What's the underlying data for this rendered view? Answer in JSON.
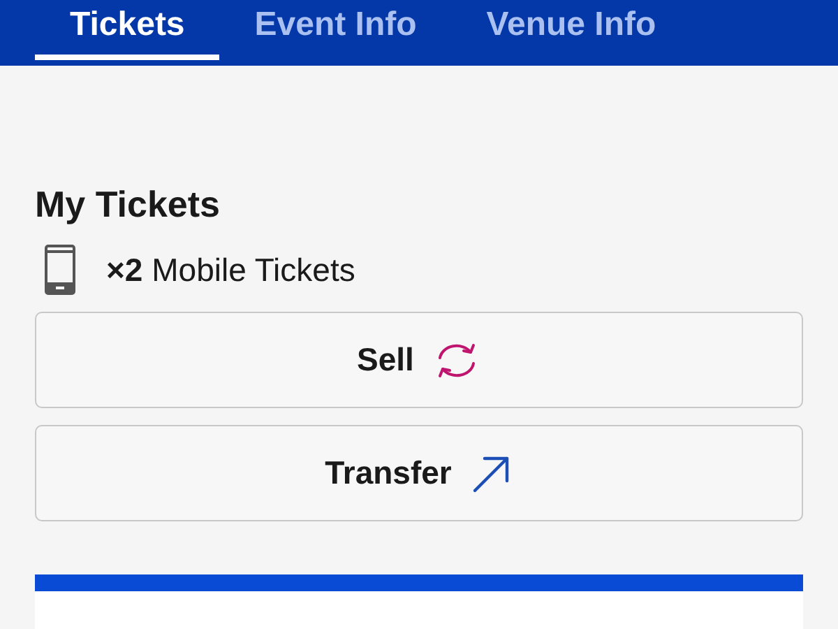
{
  "tabs": [
    {
      "label": "Tickets",
      "selected": true
    },
    {
      "label": "Event Info",
      "selected": false
    },
    {
      "label": "Venue Info",
      "selected": false
    }
  ],
  "my_tickets": {
    "title": "My Tickets",
    "summary": "**×2** Mobile Tickets"
  },
  "actions": [
    {
      "label": "Sell",
      "kind": "sell"
    },
    {
      "label": "Transfer",
      "kind": "transfer"
    }
  ]
}
